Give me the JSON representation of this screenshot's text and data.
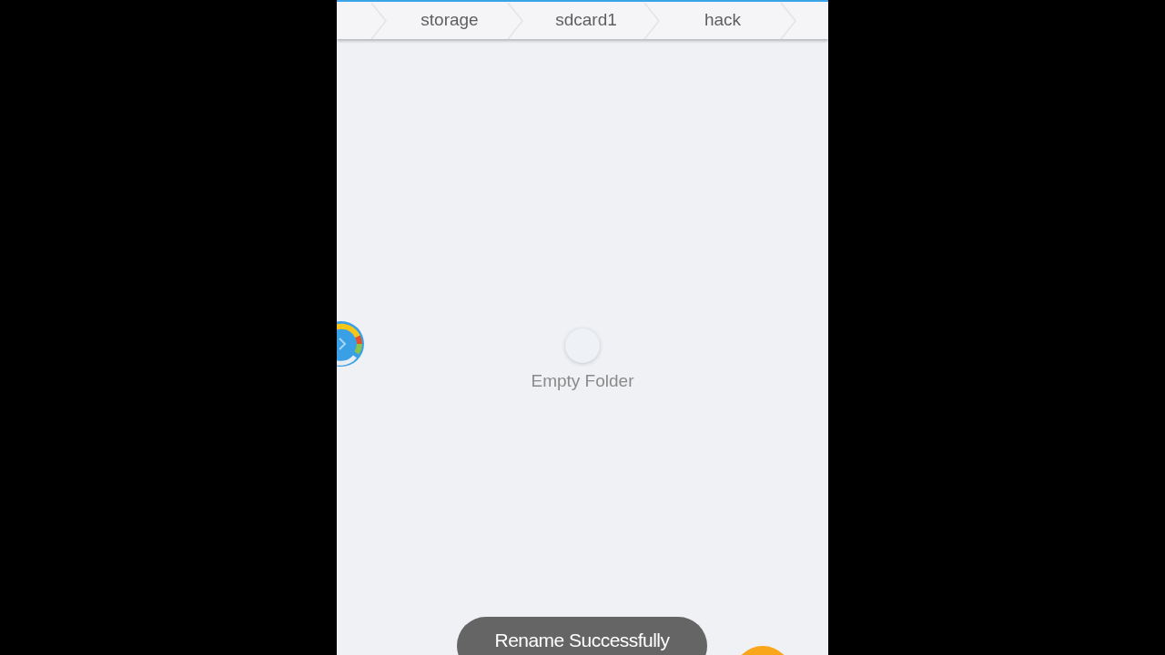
{
  "breadcrumbs": [
    {
      "label": "storage"
    },
    {
      "label": "sdcard1"
    },
    {
      "label": "hack"
    }
  ],
  "empty_state": {
    "message": "Empty Folder"
  },
  "toast": {
    "message": "Rename Successfully"
  }
}
